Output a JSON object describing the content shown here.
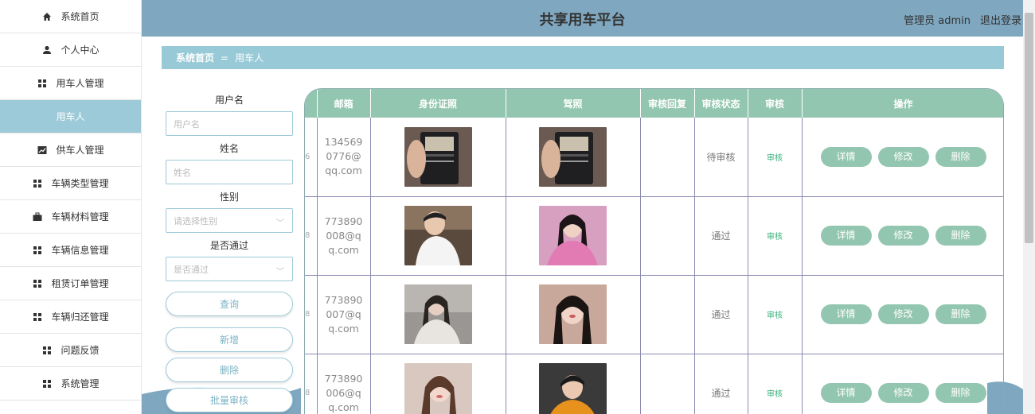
{
  "sidebar": {
    "items": [
      {
        "label": "系统首页",
        "icon": "home-icon"
      },
      {
        "label": "个人中心",
        "icon": "user-icon"
      },
      {
        "label": "用车人管理",
        "icon": "grid-icon"
      },
      {
        "label": "用车人",
        "icon": "",
        "active": true
      },
      {
        "label": "供车人管理",
        "icon": "chart-icon"
      },
      {
        "label": "车辆类型管理",
        "icon": "grid-icon"
      },
      {
        "label": "车辆材料管理",
        "icon": "briefcase-icon"
      },
      {
        "label": "车辆信息管理",
        "icon": "grid-icon"
      },
      {
        "label": "租赁订单管理",
        "icon": "grid-icon"
      },
      {
        "label": "车辆归还管理",
        "icon": "grid-icon"
      },
      {
        "label": "问题反馈",
        "icon": "grid-icon"
      },
      {
        "label": "系统管理",
        "icon": "grid-icon"
      }
    ]
  },
  "header": {
    "title": "共享用车平台",
    "user": "管理员 admin",
    "logout": "退出登录"
  },
  "breadcrumb": {
    "home": "系统首页",
    "sep": "=",
    "current": "用车人"
  },
  "form": {
    "username_label": "用户名",
    "username_placeholder": "用户名",
    "name_label": "姓名",
    "name_placeholder": "姓名",
    "gender_label": "性别",
    "gender_placeholder": "请选择性别",
    "pass_label": "是否通过",
    "pass_placeholder": "是否通过",
    "query": "查询",
    "add": "新增",
    "delete": "删除",
    "batch_audit": "批量审核"
  },
  "table": {
    "headers": [
      "",
      "邮箱",
      "身份证照",
      "驾照",
      "审核回复",
      "审核状态",
      "审核",
      "操作"
    ],
    "rows": [
      {
        "cut": "6",
        "email": "1345690776@qq.com",
        "id_photo": "id-card",
        "license": "id-card",
        "reply": "",
        "status": "待审核",
        "audit": "审核"
      },
      {
        "cut": "8",
        "email": "773890008@qq.com",
        "id_photo": "man-white",
        "license": "woman-pink",
        "reply": "",
        "status": "通过",
        "audit": "审核"
      },
      {
        "cut": "8",
        "email": "773890007@qq.com",
        "id_photo": "woman-grey",
        "license": "woman-dark",
        "reply": "",
        "status": "通过",
        "audit": "审核"
      },
      {
        "cut": "8",
        "email": "773890006@qq.com",
        "id_photo": "woman-brown",
        "license": "man-orange",
        "reply": "",
        "status": "通过",
        "audit": "审核"
      }
    ],
    "ops": {
      "detail": "详情",
      "edit": "修改",
      "del": "删除"
    }
  }
}
